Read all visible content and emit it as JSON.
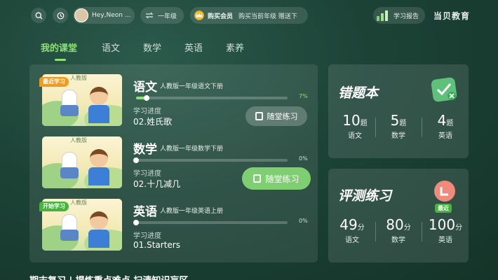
{
  "header": {
    "user_name": "Hey,Neon ...",
    "grade_label": "一年级",
    "vip_label": "购买会员",
    "vip_promo": "购买当前年级 赠送下",
    "report_label": "学习报告",
    "brand": "当贝教育"
  },
  "tabs": [
    {
      "label": "我的课堂",
      "active": true
    },
    {
      "label": "语文",
      "active": false
    },
    {
      "label": "数学",
      "active": false
    },
    {
      "label": "英语",
      "active": false
    },
    {
      "label": "素养",
      "active": false
    }
  ],
  "courses": [
    {
      "badge": "最近学习",
      "badge_type": "recent",
      "thumb_caption": "人教版",
      "subject": "语文",
      "book": "人教版一年级语文下册",
      "progress_percent": 7,
      "progress_text": "7%",
      "progress_label": "学习进度",
      "lesson": "02.姓氏歌",
      "practice_button": "随堂练习"
    },
    {
      "badge": "",
      "badge_type": "none",
      "thumb_caption": "人教版",
      "subject": "数学",
      "book": "人教版一年级数学下册",
      "progress_percent": 0,
      "progress_text": "0%",
      "progress_label": "学习进度",
      "lesson": "02.十几减几",
      "practice_button": "随堂练习"
    },
    {
      "badge": "开始学习",
      "badge_type": "start",
      "thumb_caption": "人教版",
      "subject": "英语",
      "book": "人教版一年级英语上册",
      "progress_percent": 0,
      "progress_text": "0%",
      "progress_label": "学习进度",
      "lesson": "01.Starters",
      "practice_button": ""
    }
  ],
  "mistakes": {
    "title": "错题本",
    "items": [
      {
        "value": "10",
        "unit": "题",
        "subject": "语文"
      },
      {
        "value": "5",
        "unit": "题",
        "subject": "数学"
      },
      {
        "value": "4",
        "unit": "题",
        "subject": "英语"
      }
    ]
  },
  "assessment": {
    "title": "评测练习",
    "recent_tag": "最近",
    "items": [
      {
        "value": "49",
        "unit": "分",
        "subject": "语文"
      },
      {
        "value": "80",
        "unit": "分",
        "subject": "数学"
      },
      {
        "value": "100",
        "unit": "分",
        "subject": "英语"
      }
    ]
  },
  "bottom_banner": "期末复习 | 提炼重点难点 扫清知识盲区",
  "colors": {
    "accent": "#8ee07b",
    "badge_recent": "#f29a1f",
    "badge_start": "#46b33c",
    "background": "#1c4236"
  },
  "icons": [
    "search-icon",
    "history-icon",
    "swap-icon",
    "crown-icon",
    "report-chart-icon",
    "mistake-book-icon",
    "assessment-icon",
    "practice-doc-icon"
  ]
}
